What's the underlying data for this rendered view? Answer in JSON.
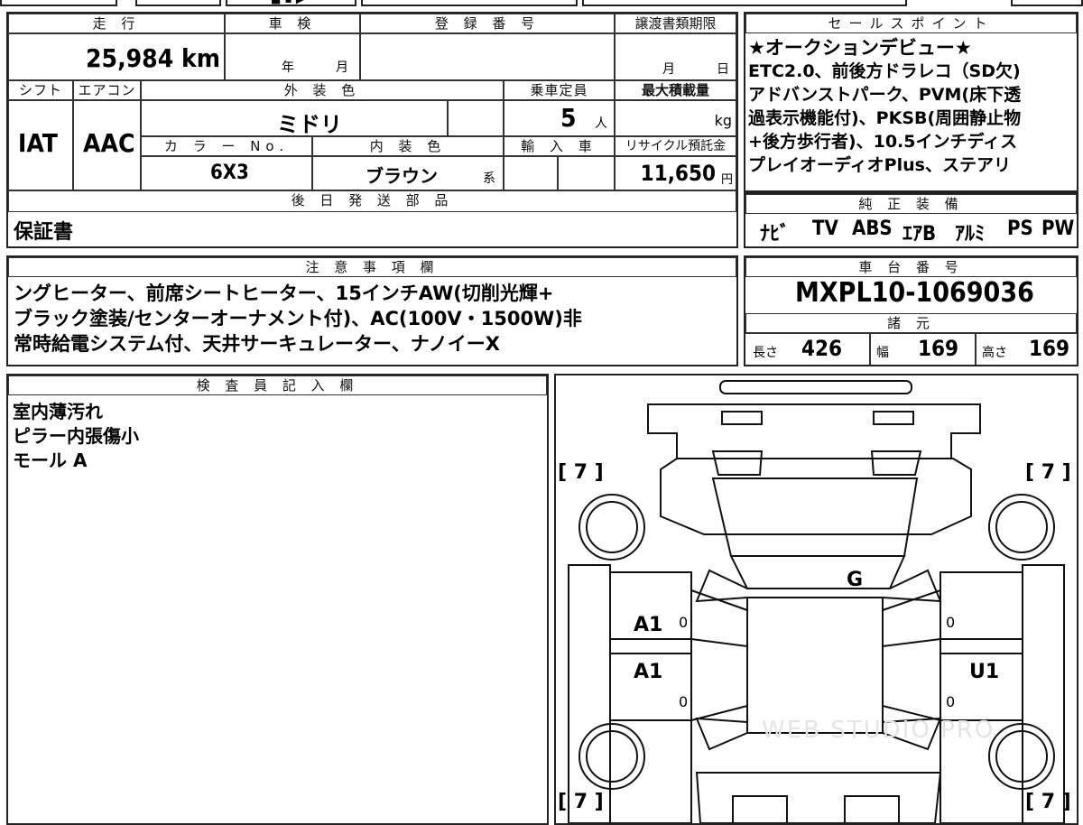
{
  "top_fragment": {
    "partial_text": "■ ▪ ▶"
  },
  "mileage": {
    "header": "走 行",
    "value": "25,984 km"
  },
  "inspection": {
    "header": "車 検",
    "year_label": "年",
    "month_label": "月"
  },
  "registration": {
    "header": "登 録 番 号",
    "value": ""
  },
  "transfer": {
    "header": "譲渡書類期限",
    "month_label": "月",
    "day_label": "日"
  },
  "shift": {
    "header": "シフト",
    "value": "IAT"
  },
  "aircon": {
    "header": "エアコン",
    "value": "AAC"
  },
  "exterior": {
    "header": "外 装 色",
    "value": "ミドリ"
  },
  "capacity": {
    "header": "乗車定員",
    "value": "5",
    "unit": "人"
  },
  "max_load": {
    "header": "最大積載量",
    "unit": "kg"
  },
  "color_no": {
    "header": "カ ラ ー No.",
    "value": "6X3"
  },
  "interior": {
    "header": "内 装 色",
    "value": "ブラウン",
    "suffix": "系"
  },
  "import": {
    "header": "輸 入 車"
  },
  "recycle": {
    "header": "リサイクル預託金",
    "value": "11,650",
    "unit": "円"
  },
  "later_parts": {
    "header": "後 日 発 送 部 品",
    "value": "保証書"
  },
  "sales_points": {
    "header": "セールスポイント",
    "lines": [
      "★オークションデビュー★",
      "ETC2.0、前後方ドラレコ（SD欠)",
      "アドバンストパーク、PVM(床下透",
      "過表示機能付)、PKSB(周囲静止物",
      "+後方歩行者)、10.5インチディス",
      "プレイオーディオPlus、ステアリ"
    ]
  },
  "equipment": {
    "header": "純 正 装 備",
    "items": [
      "ﾅﾋﾞ",
      "TV",
      "ABS",
      "ｴｱB",
      "ｱﾙﾐ",
      "PS",
      "PW"
    ]
  },
  "notes": {
    "header": "注 意 事 項 欄",
    "lines": [
      "ングヒーター、前席シートヒーター、15インチAW(切削光輝+",
      "ブラック塗装/センターオーナメント付)、AC(100V・1500W)非",
      "常時給電システム付、天井サーキュレーター、ナノイーX"
    ]
  },
  "chassis": {
    "header": "車 台 番 号",
    "value": "MXPL10-1069036"
  },
  "specs": {
    "header": "諸 元",
    "length_label": "長さ",
    "length": "426",
    "width_label": "幅",
    "width": "169",
    "height_label": "高さ",
    "height": "169"
  },
  "inspector": {
    "header": "検 査 員 記 入 欄",
    "lines": [
      "室内薄汚れ",
      "ピラー内張傷小",
      "モール A"
    ]
  },
  "diagram": {
    "tread_tl": "[ 7 ]",
    "tread_tr": "[ 7 ]",
    "tread_bl": "[ 7 ]",
    "tread_br": "[ 7 ]",
    "roof_mark": "G",
    "left_front_door": "A1",
    "left_rear_door": "A1",
    "right_rear_door": "U1",
    "zero_lf": "0",
    "zero_lr": "0",
    "zero_rf": "0",
    "zero_rr": "0",
    "watermark": "WEB STUDIO PRO"
  }
}
